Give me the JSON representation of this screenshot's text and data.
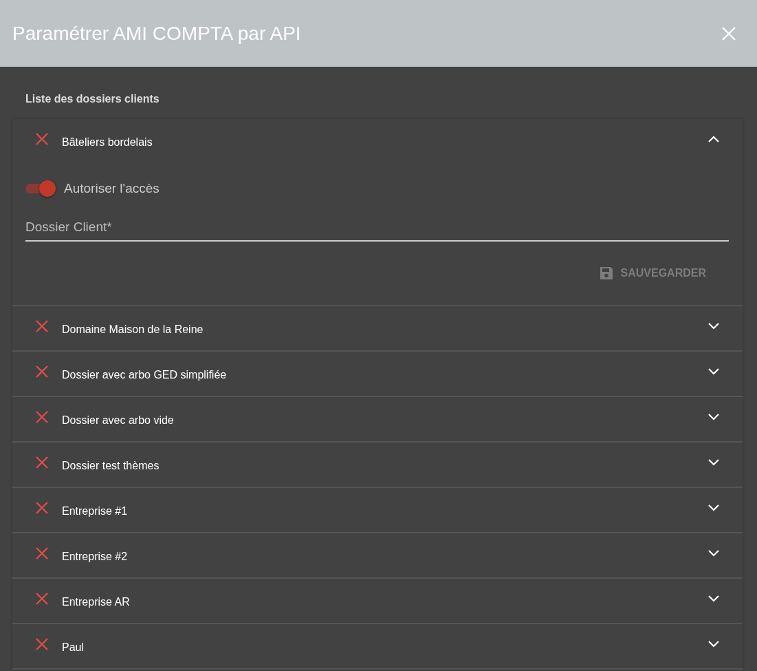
{
  "dialog": {
    "title": "Paramétrer AMI COMPTA par API"
  },
  "section_label": "Liste des dossiers clients",
  "clients": [
    {
      "name": "Bâteliers bordelais",
      "expanded": true,
      "access": {
        "label": "Autoriser l'accès",
        "on": true
      },
      "field": {
        "placeholder": "Dossier Client*"
      },
      "save": {
        "label": "SAUVEGARDER",
        "disabled": true
      }
    },
    {
      "name": "Domaine Maison de la Reine",
      "expanded": false
    },
    {
      "name": "Dossier avec arbo GED simplifiée",
      "expanded": false
    },
    {
      "name": "Dossier avec arbo vide",
      "expanded": false
    },
    {
      "name": "Dossier test thèmes",
      "expanded": false
    },
    {
      "name": "Entreprise #1",
      "expanded": false
    },
    {
      "name": "Entreprise #2",
      "expanded": false
    },
    {
      "name": "Entreprise AR",
      "expanded": false
    },
    {
      "name": "Paul",
      "expanded": false
    }
  ]
}
